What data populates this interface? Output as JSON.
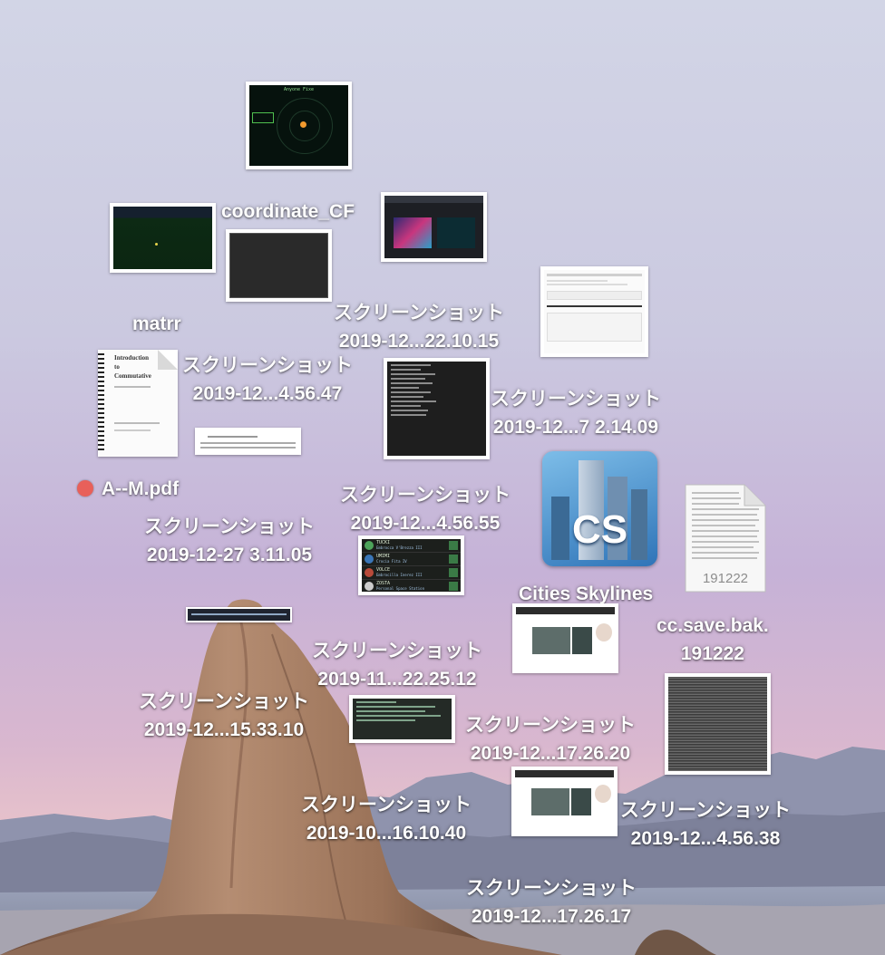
{
  "desktop": {
    "items": [
      {
        "name": "coordinate_CF",
        "kind": "image"
      },
      {
        "name": "matrr",
        "kind": "image"
      },
      {
        "name": "スクリーンショット 2019-12...22.10.15",
        "line1": "スクリーンショット",
        "line2": "2019-12...22.10.15",
        "kind": "screenshot"
      },
      {
        "name": "スクリーンショット 2019-12...4.56.47",
        "line1": "スクリーンショット",
        "line2": "2019-12...4.56.47",
        "kind": "screenshot"
      },
      {
        "name": "スクリーンショット 2019-12...7 2.14.09",
        "line1": "スクリーンショット",
        "line2": "2019-12...7 2.14.09",
        "kind": "screenshot"
      },
      {
        "name": "A--M.pdf",
        "kind": "pdf",
        "tag_color": "#e8605a"
      },
      {
        "name": "スクリーンショット 2019-12...4.56.55",
        "line1": "スクリーンショット",
        "line2": "2019-12...4.56.55",
        "kind": "screenshot"
      },
      {
        "name": "スクリーンショット 2019-12-27 3.11.05",
        "line1": "スクリーンショット",
        "line2": "2019-12-27 3.11.05",
        "kind": "screenshot"
      },
      {
        "name": "Cities Skylines",
        "kind": "app",
        "icon_text": "CS"
      },
      {
        "name": "cc.save.bak.191222",
        "line1": "cc.save.bak.",
        "line2": "191222",
        "kind": "document",
        "icon_text": "191222"
      },
      {
        "name": "スクリーンショット 2019-11...22.25.12",
        "line1": "スクリーンショット",
        "line2": "2019-11...22.25.12",
        "kind": "screenshot"
      },
      {
        "name": "スクリーンショット 2019-12...15.33.10",
        "line1": "スクリーンショット",
        "line2": "2019-12...15.33.10",
        "kind": "screenshot"
      },
      {
        "name": "スクリーンショット 2019-12...17.26.20",
        "line1": "スクリーンショット",
        "line2": "2019-12...17.26.20",
        "kind": "screenshot"
      },
      {
        "name": "スクリーンショット 2019-10...16.10.40",
        "line1": "スクリーンショット",
        "line2": "2019-10...16.10.40",
        "kind": "screenshot"
      },
      {
        "name": "スクリーンショット 2019-12...4.56.38",
        "line1": "スクリーンショット",
        "line2": "2019-12...4.56.38",
        "kind": "screenshot"
      },
      {
        "name": "スクリーンショット 2019-12...17.26.17",
        "line1": "スクリーンショット",
        "line2": "2019-12...17.26.17",
        "kind": "screenshot"
      }
    ]
  },
  "thumb_text": {
    "game_title": "Anyone Fixe",
    "pdf_title": "Introduction to Commutative",
    "game_list": [
      "TUCKI",
      "UMIMI",
      "VOLCE",
      "ZOSTA"
    ],
    "game_list_sub": [
      "Embrocca V'Brezza III",
      "Crocia Fita IV",
      "Embrocilla Inerez III",
      "Personal Space Station"
    ]
  },
  "colors": {
    "tag_red": "#e8605a",
    "label_text": "#ffffff",
    "sky_top": "#cfd2e4",
    "sky_mid": "#c6b3d6",
    "horizon": "#e3bcc8"
  }
}
